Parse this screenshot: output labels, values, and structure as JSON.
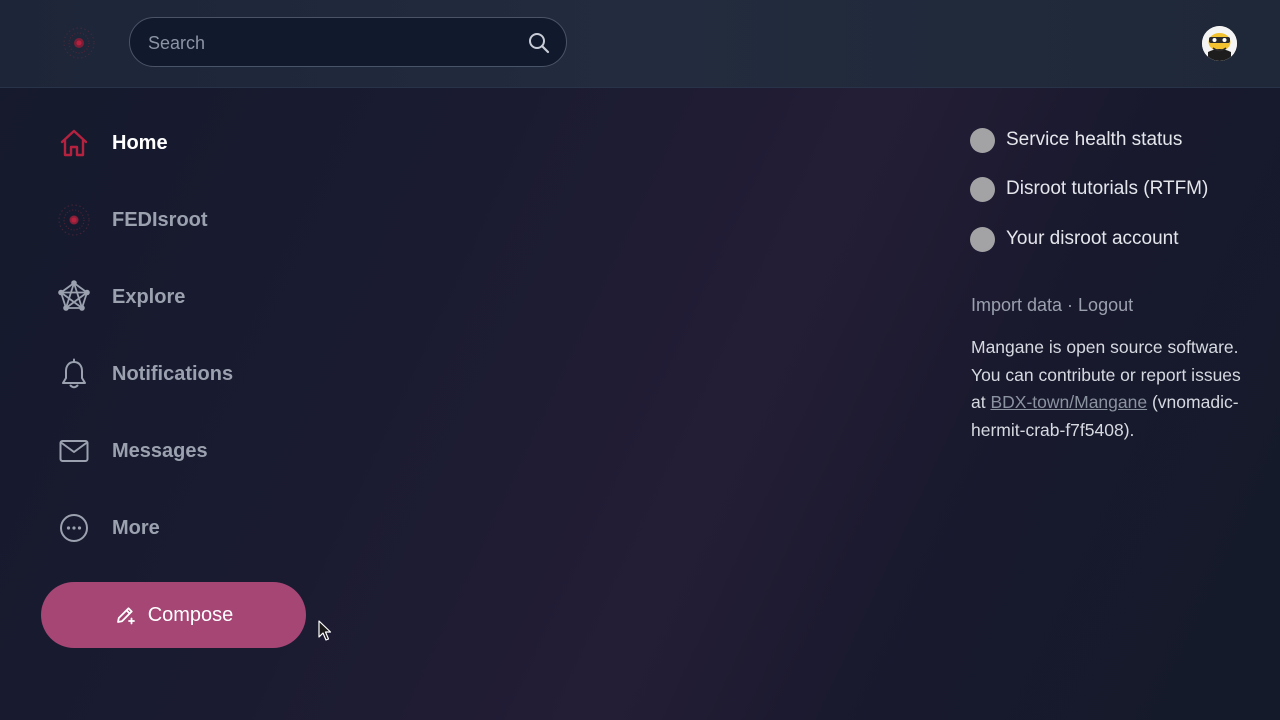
{
  "header": {
    "search_placeholder": "Search"
  },
  "nav": {
    "items": [
      {
        "label": "Home",
        "icon": "home-icon",
        "active": true
      },
      {
        "label": "FEDIsroot",
        "icon": "fedisroot-logo-icon",
        "active": false
      },
      {
        "label": "Explore",
        "icon": "fediverse-network-icon",
        "active": false
      },
      {
        "label": "Notifications",
        "icon": "bell-icon",
        "active": false
      },
      {
        "label": "Messages",
        "icon": "mail-icon",
        "active": false
      },
      {
        "label": "More",
        "icon": "more-dots-icon",
        "active": false
      }
    ],
    "compose_label": "Compose"
  },
  "sidebar_right": {
    "links": [
      {
        "label": "Service health status"
      },
      {
        "label": "Disroot tutorials (RTFM)"
      },
      {
        "label": "Your disroot account"
      }
    ],
    "import_label": "Import data",
    "separator": " · ",
    "logout_label": "Logout",
    "about_text": "Mangane is open source software. You can contribute or report issues at",
    "repo_link": "BDX-town/Mangane",
    "version": "(vnomadic-hermit-crab-f7f5408)."
  },
  "colors": {
    "accent": "#a54675",
    "active_icon": "#b5223f",
    "background": "#1a1b31",
    "topbar": "#222c3e"
  }
}
